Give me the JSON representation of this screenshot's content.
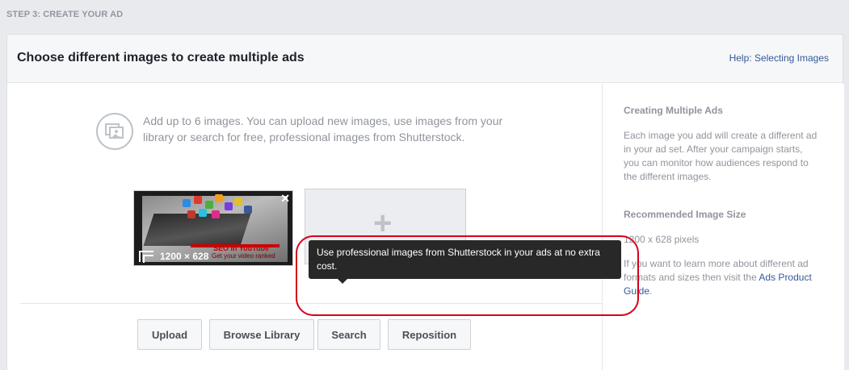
{
  "step_title": "STEP 3: CREATE YOUR AD",
  "card": {
    "title": "Choose different images to create multiple ads",
    "help_link": "Help: Selecting Images"
  },
  "intro": {
    "icon": "image-library-icon",
    "text": "Add up to 6 images. You can upload new images, use images from your library or search for free, professional images from Shutterstock."
  },
  "thumbnail": {
    "size_label": "1200 × 628",
    "overlay_title": "SEO In YouTube",
    "overlay_subtitle": "Get your video ranked"
  },
  "add_slot": {
    "plus": "+"
  },
  "buttons": {
    "upload": "Upload",
    "browse": "Browse Library",
    "search": "Search",
    "reposition": "Reposition"
  },
  "tooltip": "Use professional images from Shutterstock in your ads at no extra cost.",
  "sidebar": {
    "heading1": "Creating Multiple Ads",
    "para1": "Each image you add will create a different ad in your ad set. After your campaign starts, you can monitor how audiences respond to the different images.",
    "heading2": "Recommended Image Size",
    "size_text": "1200 x 628 pixels",
    "para3_prefix": "If you want to learn more about different ad formats and sizes then visit the ",
    "para3_link": "Ads Product Guide",
    "para3_suffix": "."
  },
  "colors": {
    "highlight": "#d6001c",
    "link": "#365899",
    "tooltip_bg": "#282828"
  }
}
